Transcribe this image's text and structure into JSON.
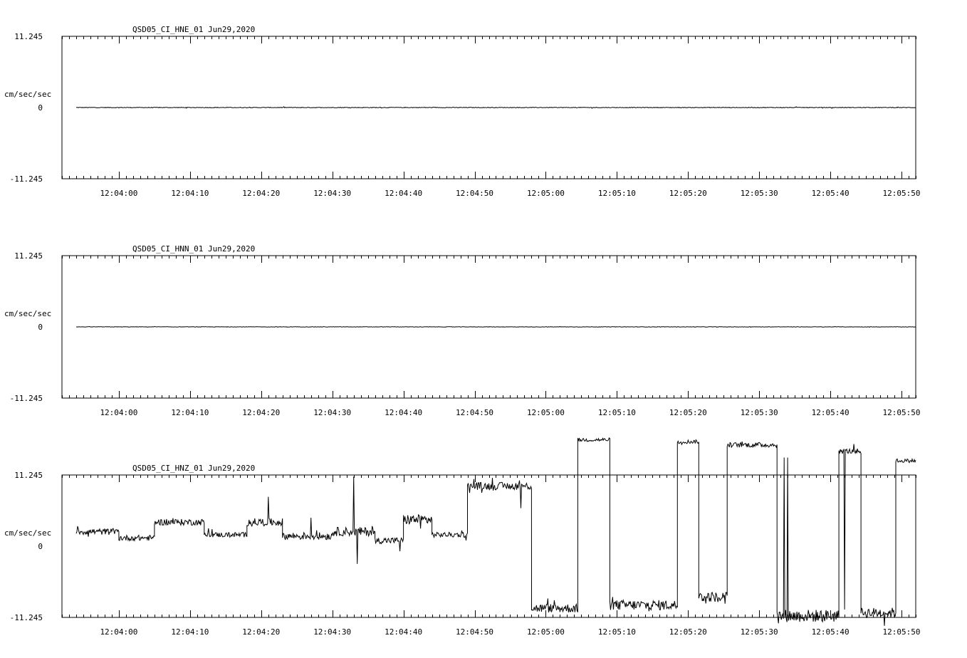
{
  "colors": {
    "background": "#ffffff",
    "foreground": "#000000"
  },
  "chart_data": [
    {
      "type": "line",
      "title": "QSD05_CI_HNE_01  Jun29,2020",
      "ylabel": "cm/sec/sec",
      "ylim": [
        -11.245,
        11.245
      ],
      "yticks": [
        "11.245",
        "0",
        "-11.245"
      ],
      "x_start": "12:03:52",
      "x_end": "12:05:52",
      "xtick_labels": [
        "12:04:00",
        "12:04:10",
        "12:04:20",
        "12:04:30",
        "12:04:40",
        "12:04:50",
        "12:05:00",
        "12:05:10",
        "12:05:20",
        "12:05:30",
        "12:05:40",
        "12:05:50"
      ],
      "trace_start": "12:03:54",
      "trace_end": "12:05:52",
      "segments": [
        {
          "t0": "12:03:54",
          "t1": "12:05:52",
          "level": 0.0,
          "noise": 0.05,
          "spikes": []
        }
      ]
    },
    {
      "type": "line",
      "title": "QSD05_CI_HNN_01  Jun29,2020",
      "ylabel": "cm/sec/sec",
      "ylim": [
        -11.245,
        11.245
      ],
      "yticks": [
        "11.245",
        "0",
        "-11.245"
      ],
      "x_start": "12:03:52",
      "x_end": "12:05:52",
      "xtick_labels": [
        "12:04:00",
        "12:04:10",
        "12:04:20",
        "12:04:30",
        "12:04:40",
        "12:04:50",
        "12:05:00",
        "12:05:10",
        "12:05:20",
        "12:05:30",
        "12:05:40",
        "12:05:50"
      ],
      "trace_start": "12:03:54",
      "trace_end": "12:05:52",
      "segments": [
        {
          "t0": "12:03:54",
          "t1": "12:05:52",
          "level": 0.0,
          "noise": 0.03,
          "spikes": []
        }
      ]
    },
    {
      "type": "line",
      "title": "QSD05_CI_HNZ_01  Jun29,2020",
      "ylabel": "cm/sec/sec",
      "ylim": [
        -11.245,
        11.245
      ],
      "yticks": [
        "11.245",
        "0",
        "-11.245"
      ],
      "x_start": "12:03:52",
      "x_end": "12:05:52",
      "xtick_labels": [
        "12:04:00",
        "12:04:10",
        "12:04:20",
        "12:04:30",
        "12:04:40",
        "12:04:50",
        "12:05:00",
        "12:05:10",
        "12:05:20",
        "12:05:30",
        "12:05:40",
        "12:05:50"
      ],
      "trace_start": "12:03:54",
      "trace_end": "12:05:52",
      "segments": [
        {
          "t0": "12:03:54",
          "t1": "12:04:00",
          "level": 2.3,
          "noise": 0.5,
          "spikes": []
        },
        {
          "t0": "12:04:00",
          "t1": "12:04:05",
          "level": 1.3,
          "noise": 0.45,
          "spikes": []
        },
        {
          "t0": "12:04:05",
          "t1": "12:04:12",
          "level": 3.8,
          "noise": 0.5,
          "spikes": []
        },
        {
          "t0": "12:04:12",
          "t1": "12:04:18",
          "level": 1.8,
          "noise": 0.4,
          "spikes": []
        },
        {
          "t0": "12:04:18",
          "t1": "12:04:23",
          "level": 3.8,
          "noise": 0.6,
          "spikes": [
            [
              "12:04:21",
              7.8
            ]
          ]
        },
        {
          "t0": "12:04:23",
          "t1": "12:04:30",
          "level": 1.6,
          "noise": 0.6,
          "spikes": [
            [
              "12:04:27",
              4.5
            ]
          ]
        },
        {
          "t0": "12:04:30",
          "t1": "12:04:36",
          "level": 2.3,
          "noise": 0.7,
          "spikes": [
            [
              "12:04:33",
              11.0
            ],
            [
              "12:04:33.5",
              -2.8
            ]
          ]
        },
        {
          "t0": "12:04:36",
          "t1": "12:04:40",
          "level": 0.9,
          "noise": 0.5,
          "spikes": [
            [
              "12:04:39.5",
              -0.8
            ]
          ]
        },
        {
          "t0": "12:04:40",
          "t1": "12:04:44",
          "level": 4.2,
          "noise": 0.8,
          "spikes": []
        },
        {
          "t0": "12:04:44",
          "t1": "12:04:49",
          "level": 1.8,
          "noise": 0.4,
          "spikes": []
        },
        {
          "t0": "12:04:49",
          "t1": "12:04:58",
          "level": 9.5,
          "noise": 0.6,
          "spikes": [
            [
              "12:04:56.5",
              6.0
            ]
          ]
        },
        {
          "t0": "12:04:58",
          "t1": "12:05:04.5",
          "level": -9.8,
          "noise": 0.7,
          "spikes": []
        },
        {
          "t0": "12:05:04.5",
          "t1": "12:05:09",
          "level": 16.8,
          "noise": 0.3,
          "spikes": []
        },
        {
          "t0": "12:05:09",
          "t1": "12:05:18.5",
          "level": -9.3,
          "noise": 0.8,
          "spikes": []
        },
        {
          "t0": "12:05:18.5",
          "t1": "12:05:21.5",
          "level": 16.5,
          "noise": 0.3,
          "spikes": []
        },
        {
          "t0": "12:05:21.5",
          "t1": "12:05:25.5",
          "level": -8.0,
          "noise": 0.8,
          "spikes": []
        },
        {
          "t0": "12:05:25.5",
          "t1": "12:05:32.5",
          "level": 16.0,
          "noise": 0.4,
          "spikes": []
        },
        {
          "t0": "12:05:32.5",
          "t1": "12:05:41.2",
          "level": -11.0,
          "noise": 1.0,
          "spikes": [
            [
              "12:05:33.5",
              14.0
            ],
            [
              "12:05:34",
              14.0
            ]
          ]
        },
        {
          "t0": "12:05:41.2",
          "t1": "12:05:44.3",
          "level": 15.0,
          "noise": 0.4,
          "spikes": [
            [
              "12:05:42",
              -10.0
            ]
          ]
        },
        {
          "t0": "12:05:44.3",
          "t1": "12:05:49.2",
          "level": -10.5,
          "noise": 0.8,
          "spikes": []
        },
        {
          "t0": "12:05:49.2",
          "t1": "12:05:52",
          "level": 13.5,
          "noise": 0.3,
          "spikes": []
        }
      ]
    }
  ]
}
